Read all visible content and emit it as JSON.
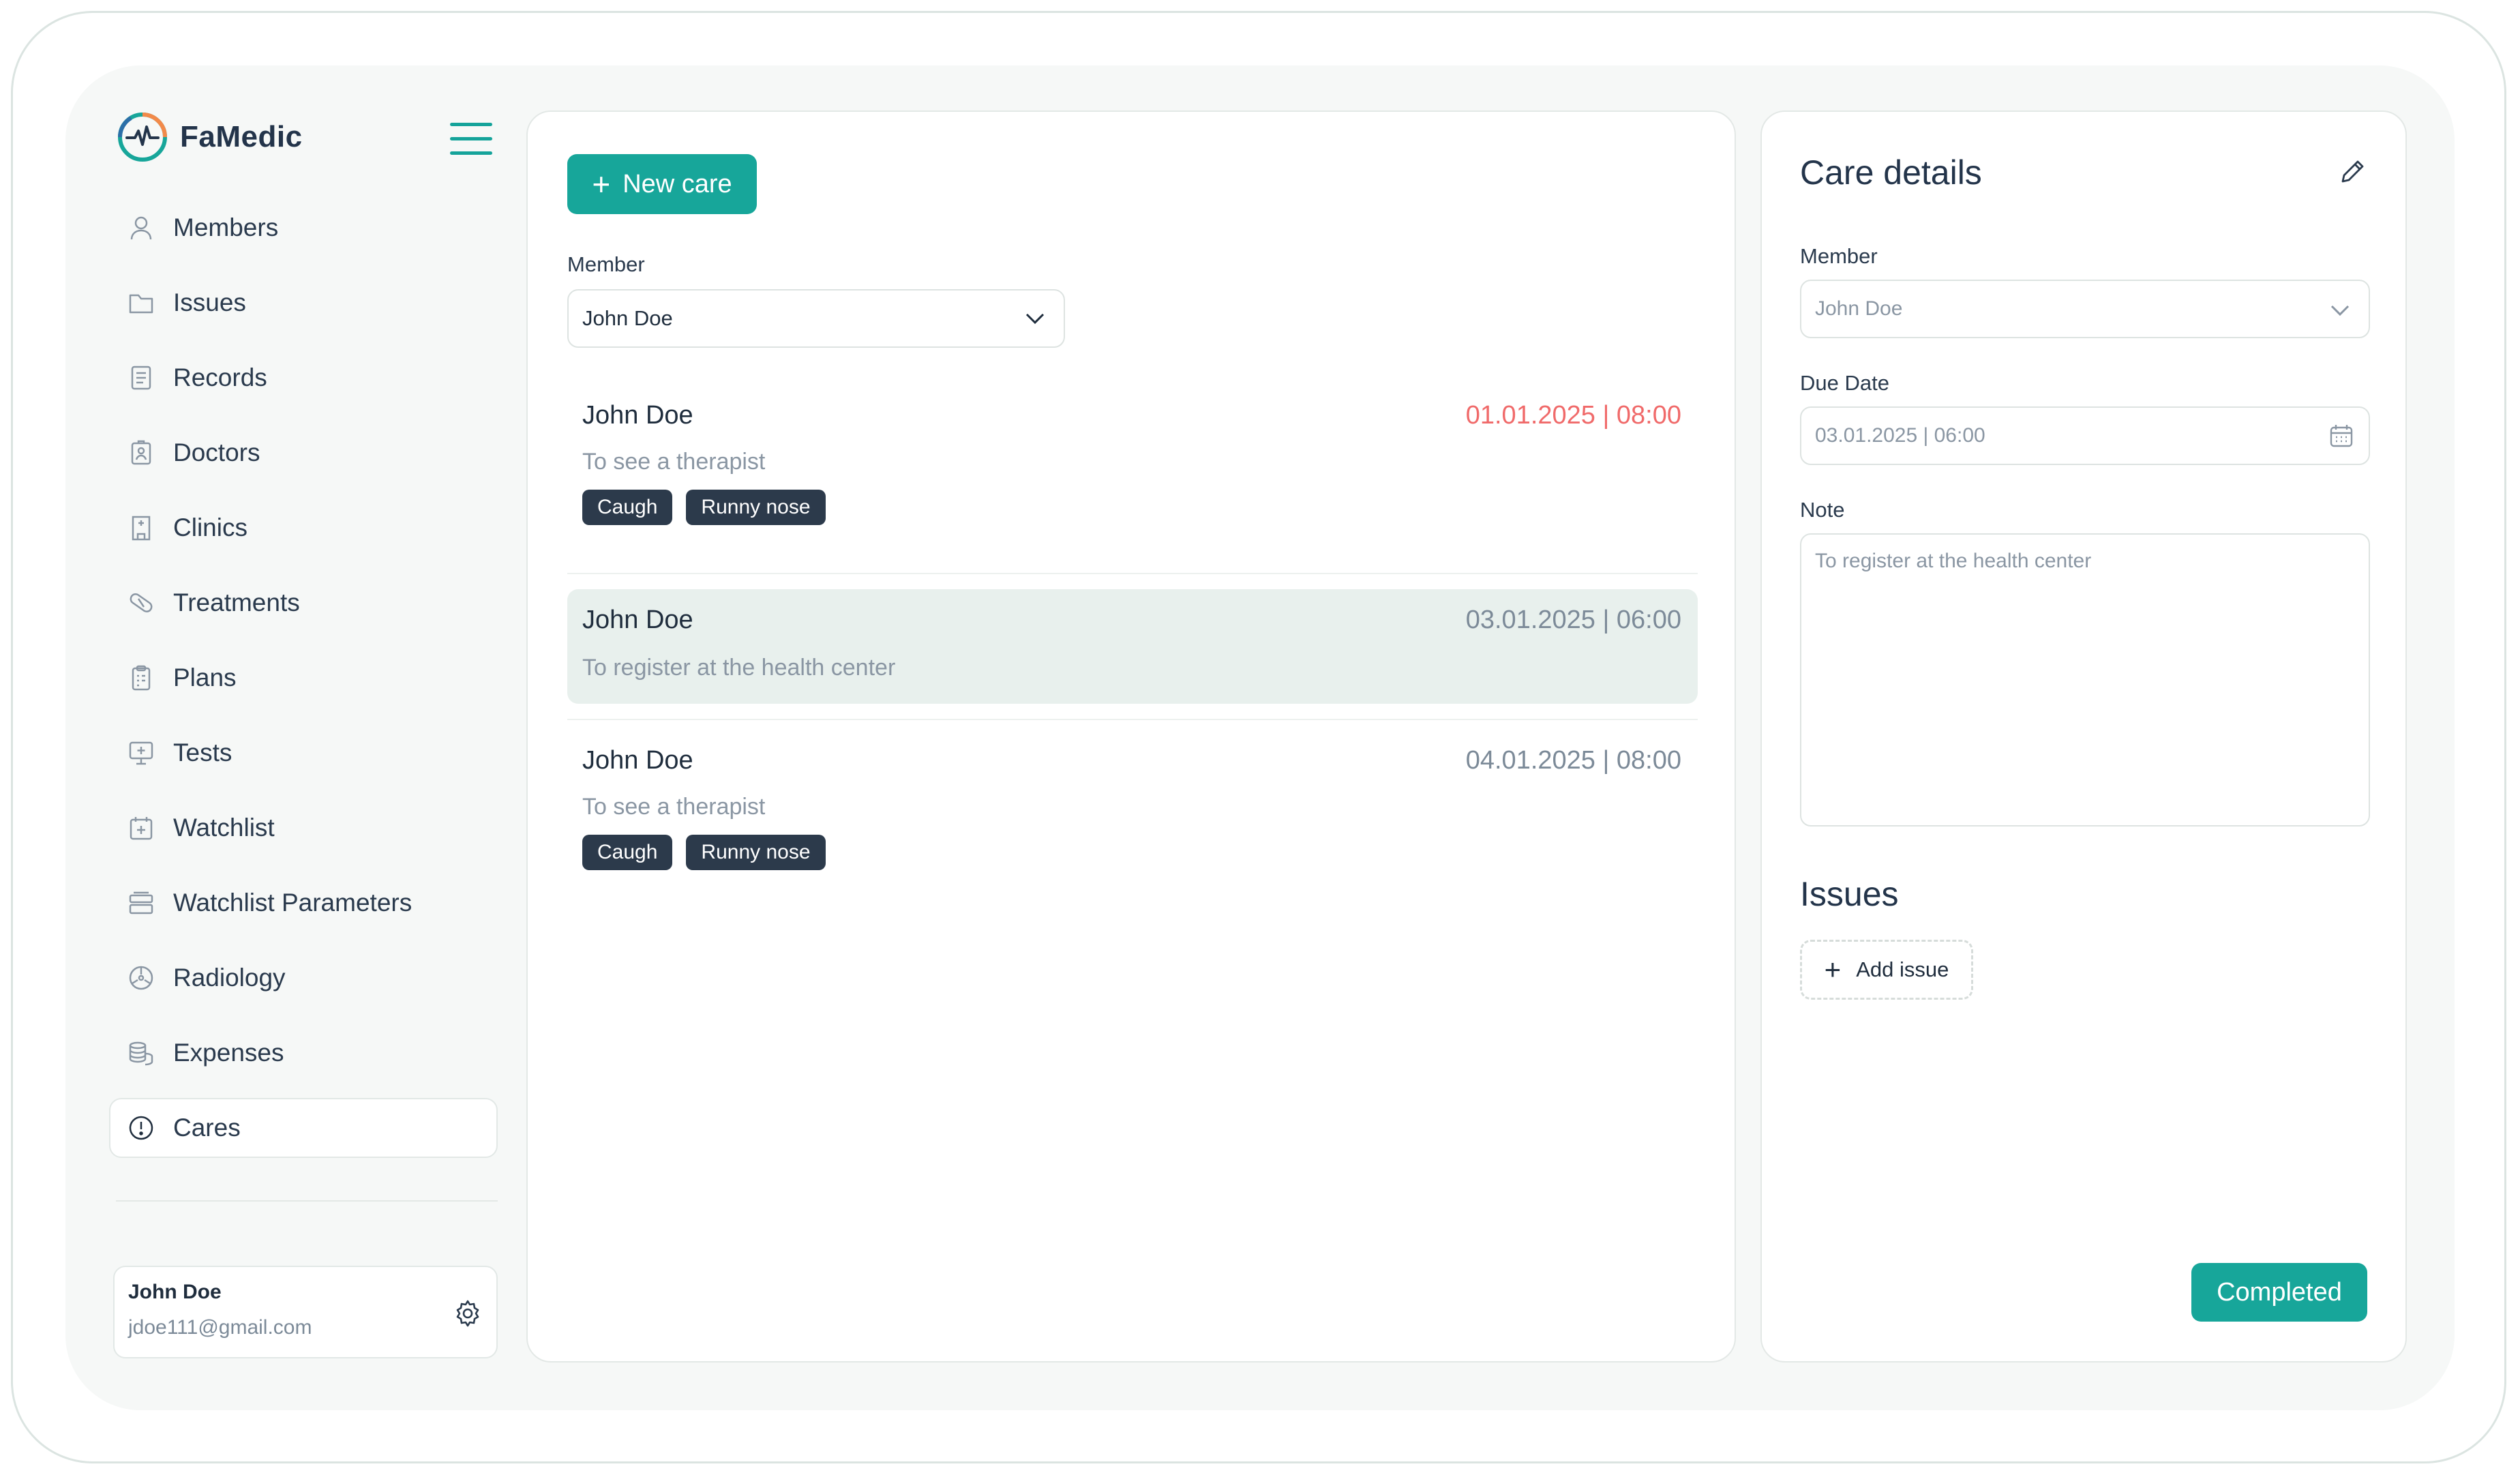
{
  "app": {
    "name": "FaMedic"
  },
  "colors": {
    "accent": "#17a69a",
    "overdue": "#f06a6a",
    "tag_bg": "#2c3a4b",
    "selected_bg": "#e8f0ed"
  },
  "sidebar": {
    "items": [
      {
        "label": "Members",
        "icon": "user-icon"
      },
      {
        "label": "Issues",
        "icon": "folder-icon"
      },
      {
        "label": "Records",
        "icon": "document-icon"
      },
      {
        "label": "Doctors",
        "icon": "doctor-badge-icon"
      },
      {
        "label": "Clinics",
        "icon": "hospital-icon"
      },
      {
        "label": "Treatments",
        "icon": "pill-icon"
      },
      {
        "label": "Plans",
        "icon": "clipboard-icon"
      },
      {
        "label": "Tests",
        "icon": "monitor-plus-icon"
      },
      {
        "label": "Watchlist",
        "icon": "calendar-plus-icon"
      },
      {
        "label": "Watchlist Parameters",
        "icon": "stack-icon"
      },
      {
        "label": "Radiology",
        "icon": "radiation-icon"
      },
      {
        "label": "Expenses",
        "icon": "coins-icon"
      },
      {
        "label": "Cares",
        "icon": "alert-circle-icon",
        "active": true
      }
    ],
    "user": {
      "name": "John Doe",
      "email": "jdoe111@gmail.com"
    }
  },
  "main": {
    "new_care_label": "New care",
    "member_label": "Member",
    "member_value": "John Doe",
    "cares": [
      {
        "name": "John Doe",
        "date": "01.01.2025 | 08:00",
        "overdue": true,
        "description": "To see a therapist",
        "tags": [
          "Caugh",
          "Runny nose"
        ]
      },
      {
        "name": "John Doe",
        "date": "03.01.2025 | 06:00",
        "overdue": false,
        "selected": true,
        "description": "To register at the health center",
        "tags": []
      },
      {
        "name": "John Doe",
        "date": "04.01.2025 | 08:00",
        "overdue": false,
        "description": "To see a therapist",
        "tags": [
          "Caugh",
          "Runny nose"
        ]
      }
    ]
  },
  "details": {
    "title": "Care details",
    "member_label": "Member",
    "member_value": "John Doe",
    "due_date_label": "Due Date",
    "due_date_value": "03.01.2025 | 06:00",
    "note_label": "Note",
    "note_value": "To register at the health center",
    "issues_title": "Issues",
    "add_issue_label": "Add issue",
    "completed_label": "Completed"
  }
}
